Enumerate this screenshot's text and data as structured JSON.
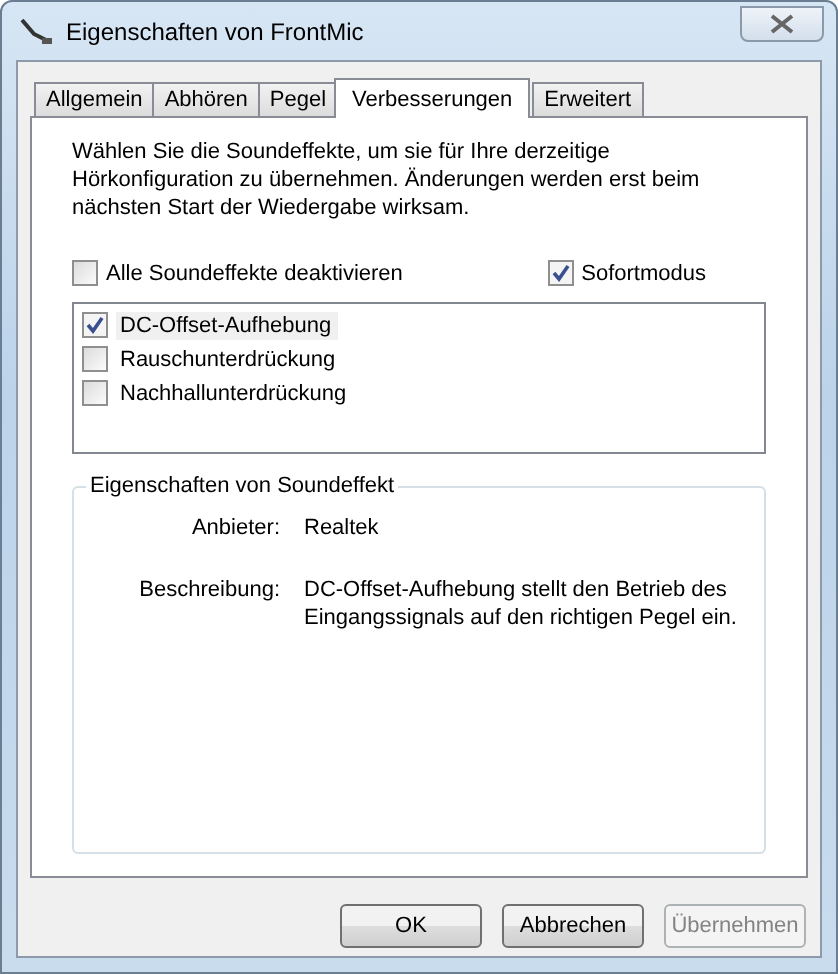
{
  "window": {
    "title": "Eigenschaften von FrontMic"
  },
  "tabs": [
    {
      "label": "Allgemein",
      "selected": false
    },
    {
      "label": "Abhören",
      "selected": false
    },
    {
      "label": "Pegel",
      "selected": false
    },
    {
      "label": "Verbesserungen",
      "selected": true
    },
    {
      "label": "Erweitert",
      "selected": false
    }
  ],
  "intro": "Wählen Sie die Soundeffekte, um sie für Ihre derzeitige Hörkonfiguration zu übernehmen. Änderungen werden erst beim nächsten Start der Wiedergabe wirksam.",
  "options": [
    {
      "label": "Alle Soundeffekte deaktivieren",
      "checked": false
    },
    {
      "label": "Sofortmodus",
      "checked": true
    }
  ],
  "effects": [
    {
      "label": "DC-Offset-Aufhebung",
      "checked": true,
      "selected": true
    },
    {
      "label": "Rauschunterdrückung",
      "checked": false,
      "selected": false
    },
    {
      "label": "Nachhallunterdrückung",
      "checked": false,
      "selected": false
    }
  ],
  "properties": {
    "title": "Eigenschaften von Soundeffekt",
    "rows": [
      {
        "label": "Anbieter:",
        "value": "Realtek"
      },
      {
        "label": "Beschreibung:",
        "value": "DC-Offset-Aufhebung stellt den Betrieb des Eingangssignals auf den richtigen Pegel ein."
      }
    ]
  },
  "buttons": [
    {
      "label": "OK",
      "disabled": false
    },
    {
      "label": "Abbrechen",
      "disabled": false
    },
    {
      "label": "Übernehmen",
      "disabled": true
    }
  ]
}
